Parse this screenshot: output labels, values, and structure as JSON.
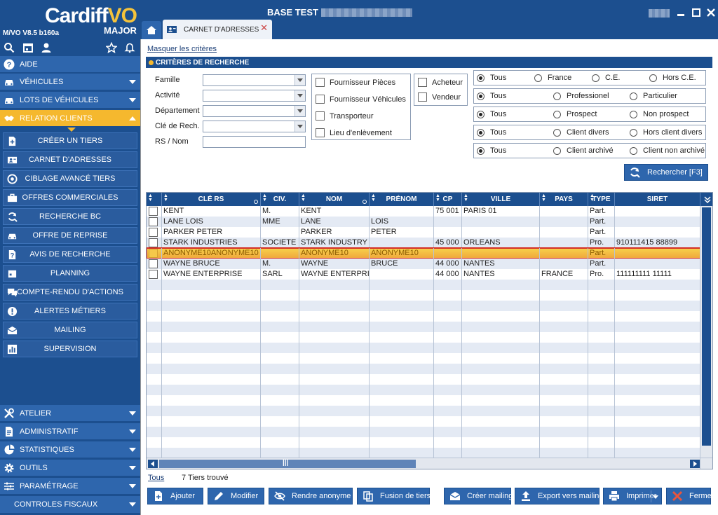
{
  "app": {
    "brand_main": "Cardiff",
    "brand_accent": "VO",
    "brand_sub": "MAJOR",
    "version": "M/VO V8.5 b160a",
    "base_title": "BASE TEST",
    "colors": {
      "primary": "#1c4f8f",
      "accent": "#f5b82e",
      "selection": "#f0a53c",
      "selection_border": "#d42d25"
    }
  },
  "tabs": [
    {
      "icon": "home-icon"
    },
    {
      "label": "CARNET D'ADRESSES",
      "icon": "address-book-icon",
      "close": "✕"
    }
  ],
  "sidebar": {
    "aide": "AIDE",
    "sections_top": [
      {
        "label": "VÉHICULES",
        "icon": "car-icon"
      },
      {
        "label": "LOTS DE VÉHICULES",
        "icon": "car-icon"
      },
      {
        "label": "RELATION CLIENTS",
        "icon": "handshake-icon"
      }
    ],
    "relation_items": [
      {
        "label": "CRÉER UN TIERS",
        "icon": "new-file-icon"
      },
      {
        "label": "CARNET D'ADRESSES",
        "icon": "address-book-icon"
      },
      {
        "label": "CIBLAGE AVANCÉ TIERS",
        "icon": "target-icon"
      },
      {
        "label": "OFFRES COMMERCIALES",
        "icon": "briefcase-icon"
      },
      {
        "label": "RECHERCHE BC",
        "icon": "refresh-search-icon"
      },
      {
        "label": "OFFRE DE REPRISE",
        "icon": "car-icon"
      },
      {
        "label": "AVIS DE RECHERCHE",
        "icon": "question-icon"
      },
      {
        "label": "PLANNING",
        "icon": "calendar-icon"
      },
      {
        "label": "COMPTE-RENDU D'ACTIONS",
        "icon": "chat-icon"
      },
      {
        "label": "ALERTES MÉTIERS",
        "icon": "alert-icon"
      },
      {
        "label": "MAILING",
        "icon": "mail-icon"
      },
      {
        "label": "SUPERVISION",
        "icon": "bar-chart-icon"
      }
    ],
    "sections_bottom": [
      {
        "label": "ATELIER",
        "icon": "tools-icon"
      },
      {
        "label": "ADMINISTRATIF",
        "icon": "document-icon"
      },
      {
        "label": "STATISTIQUES",
        "icon": "pie-chart-icon"
      },
      {
        "label": "OUTILS",
        "icon": "gear-icon"
      },
      {
        "label": "PARAMÉTRAGE",
        "icon": "sliders-icon"
      },
      {
        "label": "CONTROLES FISCAUX",
        "icon": ""
      }
    ]
  },
  "criteria": {
    "toggle_link": "Masquer les critères",
    "header": "CRITÈRES DE RECHERCHE",
    "fields": [
      {
        "label": "Famille",
        "type": "select",
        "value": ""
      },
      {
        "label": "Activité",
        "type": "select",
        "value": ""
      },
      {
        "label": "Département",
        "type": "select",
        "value": ""
      },
      {
        "label": "Clé de Rech.",
        "type": "select",
        "value": ""
      },
      {
        "label": "RS / Nom",
        "type": "text",
        "value": ""
      }
    ],
    "checkboxes_a": [
      "Fournisseur Pièces",
      "Fournisseur Véhicules",
      "Transporteur",
      "Lieu d'enlèvement"
    ],
    "checkboxes_b": [
      "Acheteur",
      "Vendeur"
    ],
    "radio_groups": [
      {
        "options": [
          "Tous",
          "France",
          "C.E.",
          "Hors C.E."
        ],
        "selected": 0
      },
      {
        "options": [
          "Tous",
          "Professionel",
          "Particulier"
        ],
        "selected": 0
      },
      {
        "options": [
          "Tous",
          "Prospect",
          "Non prospect"
        ],
        "selected": 0
      },
      {
        "options": [
          "Tous",
          "Client divers",
          "Hors client divers"
        ],
        "selected": 0
      },
      {
        "options": [
          "Tous",
          "Client archivé",
          "Client non archivé"
        ],
        "selected": 0
      }
    ],
    "search_button": "Rechercher [F3]"
  },
  "grid": {
    "columns": [
      "CLÉ RS",
      "CIV.",
      "NOM",
      "PRÉNOM",
      "CP",
      "VILLE",
      "PAYS",
      "TYPE",
      "SIRET"
    ],
    "rows": [
      [
        "KENT",
        "M.",
        "KENT",
        "",
        "75 001",
        "PARIS 01",
        "",
        "Part.",
        ""
      ],
      [
        "LANE LOIS",
        "MME",
        "LANE",
        "LOIS",
        "",
        "",
        "",
        "Part.",
        ""
      ],
      [
        "PARKER PETER",
        "",
        "PARKER",
        "PETER",
        "",
        "",
        "",
        "Part.",
        ""
      ],
      [
        "STARK INDUSTRIES",
        "SOCIETE",
        "STARK INDUSTRY",
        "",
        "45 000",
        "ORLEANS",
        "",
        "Pro.",
        "910111415 88899"
      ],
      [
        "ANONYME10ANONYME10",
        "",
        "ANONYME10",
        "ANONYME10",
        "",
        "",
        "",
        "Part.",
        ""
      ],
      [
        "WAYNE BRUCE",
        "M.",
        "WAYNE",
        "BRUCE",
        "44 000",
        "NANTES",
        "",
        "Part.",
        ""
      ],
      [
        "WAYNE ENTERPRISE",
        "SARL",
        "WAYNE ENTERPRISE",
        "",
        "44 000",
        "NANTES",
        "FRANCE",
        "Pro.",
        "111111111 11111"
      ]
    ],
    "selected_row": 4
  },
  "footer": {
    "filter_link": "Tous",
    "count": "7 Tiers trouvé"
  },
  "actions": [
    {
      "label": "Ajouter",
      "icon": "add-icon"
    },
    {
      "label": "Modifier",
      "icon": "pencil-icon"
    },
    {
      "label": "Rendre anonyme",
      "icon": "eye-off-icon"
    },
    {
      "label": "Fusion de tiers",
      "icon": "copy-icon"
    },
    {
      "label": "Créer mailing",
      "icon": "mail-icon"
    },
    {
      "label": "Export vers mailing",
      "icon": "upload-icon"
    },
    {
      "label": "Imprimer",
      "icon": "printer-icon"
    },
    {
      "label": "Fermer",
      "icon": "close-icon"
    }
  ]
}
